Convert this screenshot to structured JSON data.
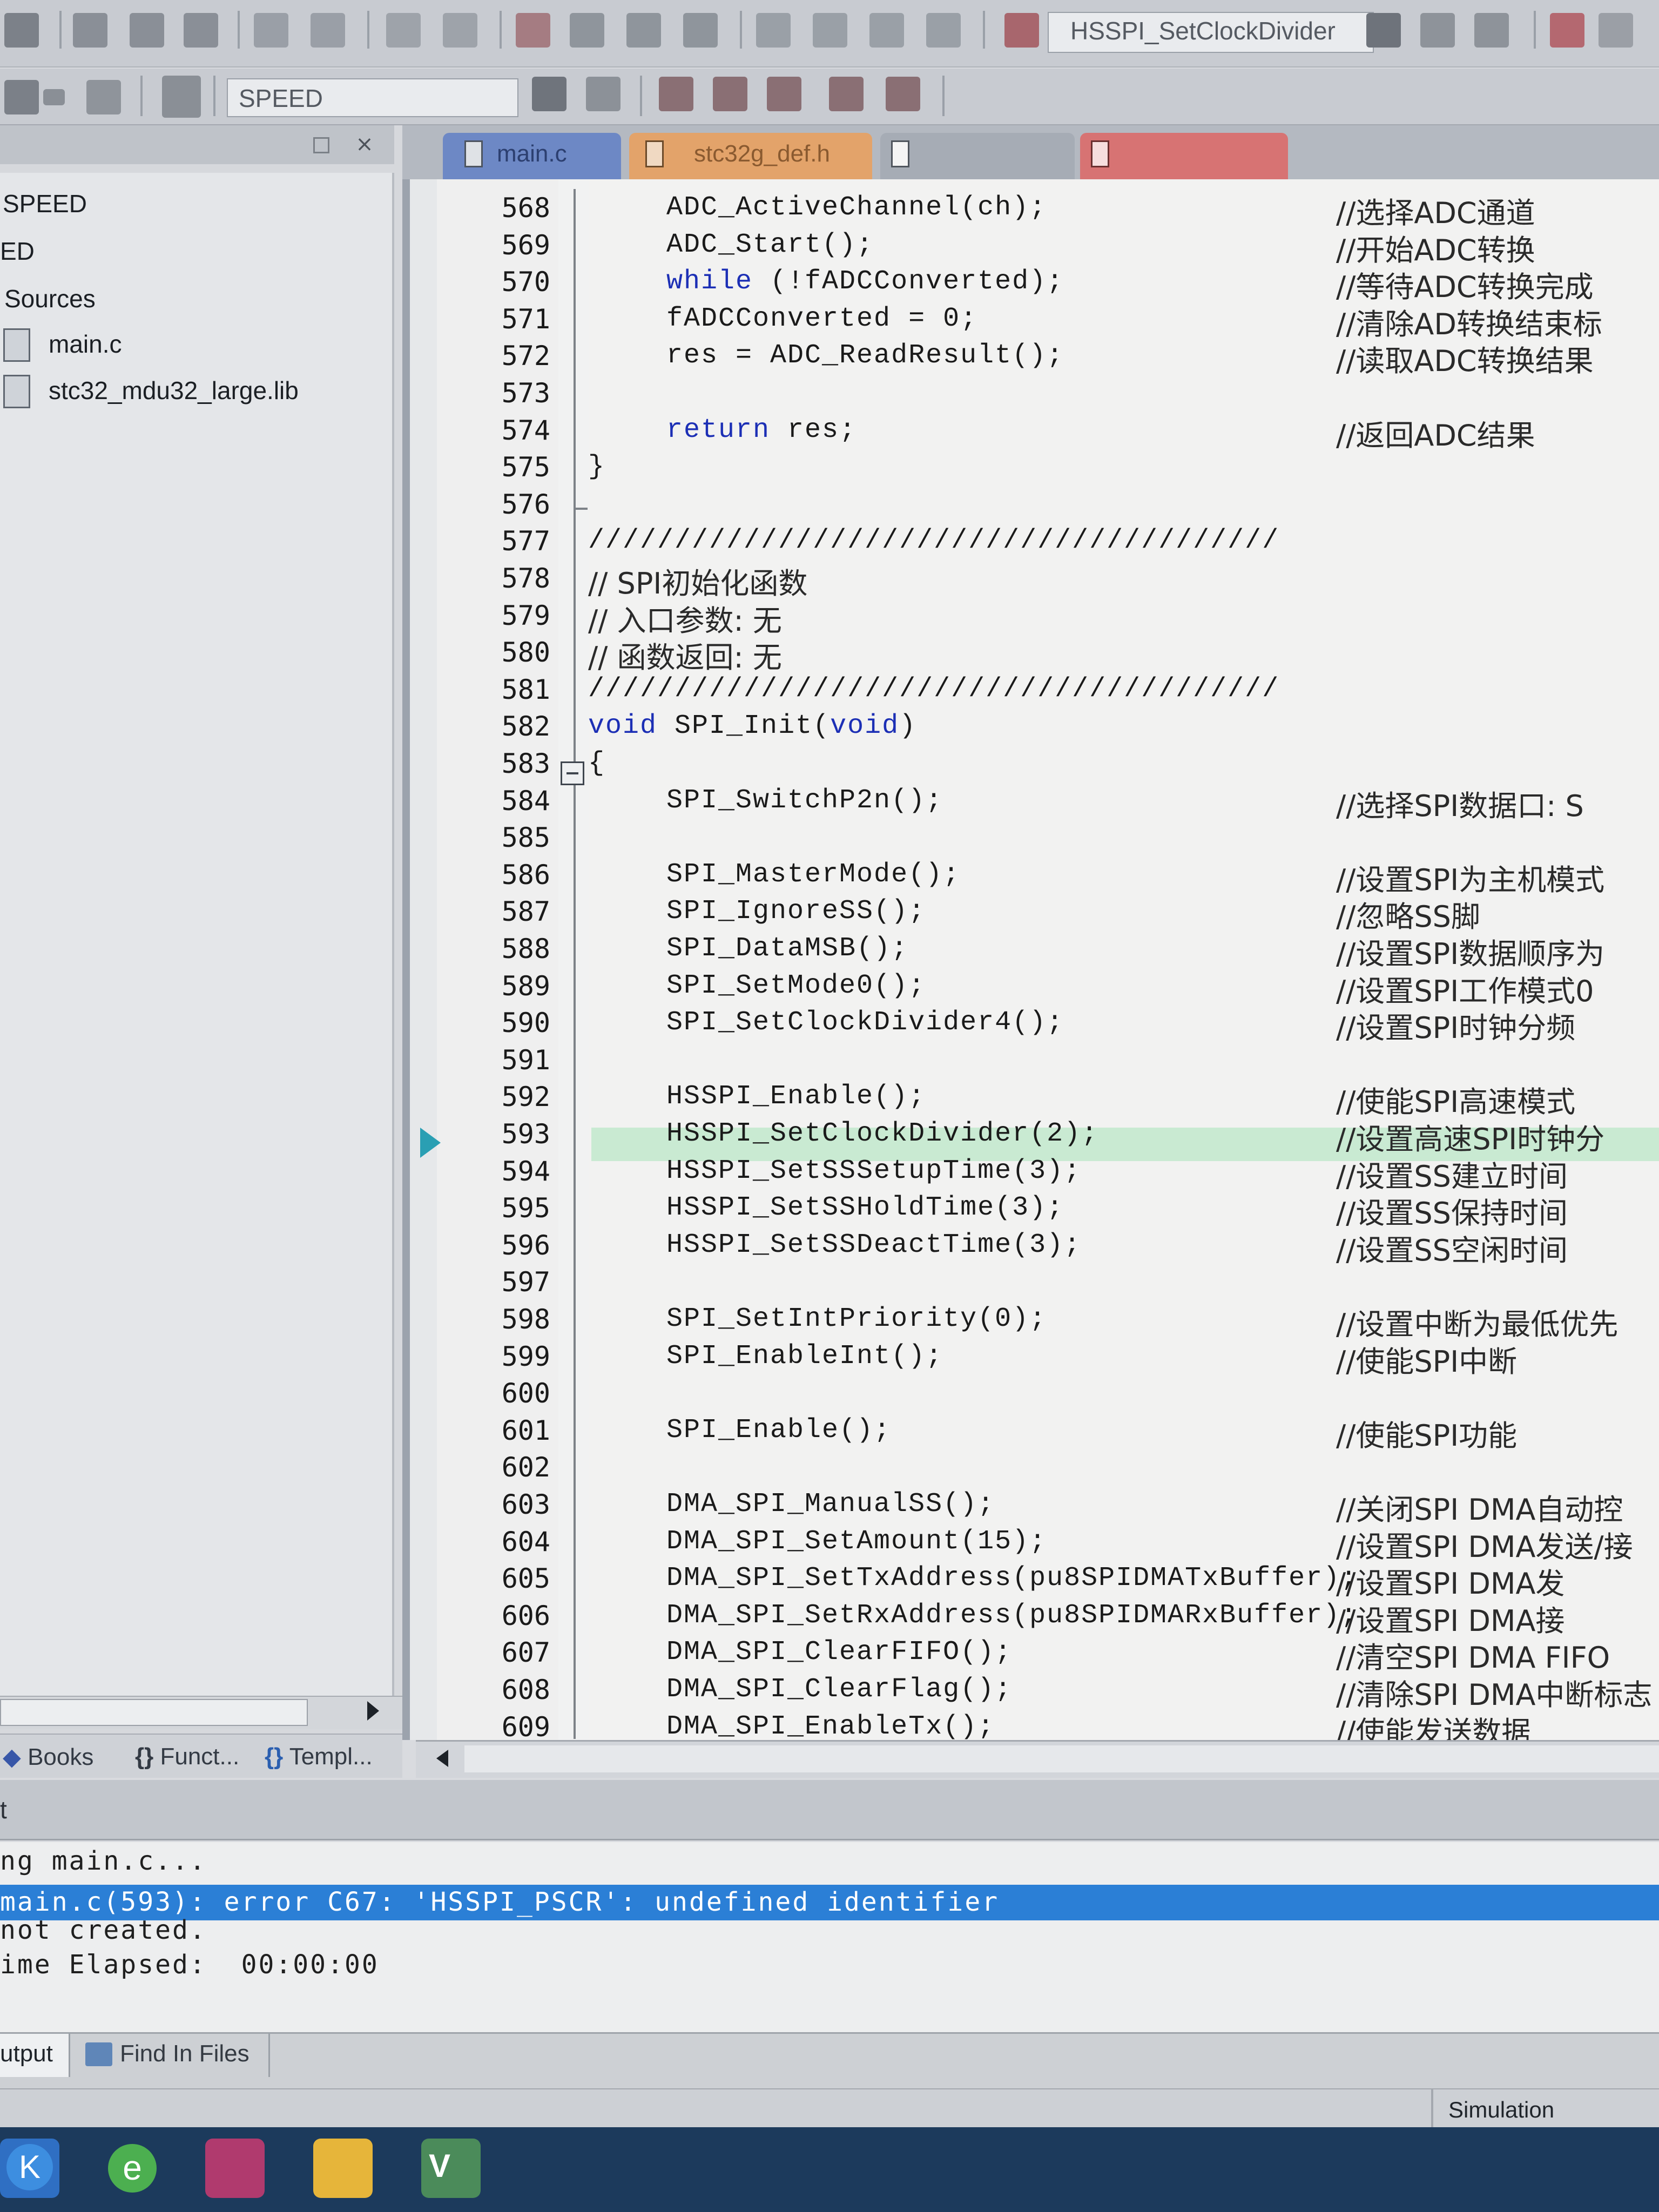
{
  "toolbar": {
    "function_combo": "HSSPI_SetClockDivider",
    "target_combo": "SPEED"
  },
  "project": {
    "items": [
      {
        "label": "SPEED"
      },
      {
        "label": "ED"
      },
      {
        "label": "Sources"
      },
      {
        "label": "main.c"
      },
      {
        "label": "stc32_mdu32_large.lib"
      }
    ],
    "tabs": [
      "Books",
      "Funct...",
      "Templ..."
    ]
  },
  "editor": {
    "tabs": [
      "main.c",
      "stc32g_def.h",
      "",
      ""
    ],
    "active_line": 593,
    "lines": [
      {
        "n": "568",
        "code": "ADC_ActiveChannel(ch);",
        "comment": "//选择ADC通道",
        "indent": 1
      },
      {
        "n": "569",
        "code": "ADC_Start();",
        "comment": "//开始ADC转换",
        "indent": 1
      },
      {
        "n": "570",
        "kw": "while",
        "code": " (!fADCConverted);",
        "comment": "//等待ADC转换完成",
        "indent": 1
      },
      {
        "n": "571",
        "code": "fADCConverted = 0;",
        "comment": "//清除AD转换结束标",
        "indent": 1
      },
      {
        "n": "572",
        "code": "res = ADC_ReadResult();",
        "comment": "//读取ADC转换结果",
        "indent": 1
      },
      {
        "n": "573",
        "code": "",
        "comment": "",
        "indent": 1
      },
      {
        "n": "574",
        "kw": "return",
        "code": " res;",
        "comment": "//返回ADC结果",
        "indent": 1
      },
      {
        "n": "575",
        "code": "}",
        "comment": "",
        "indent": 0
      },
      {
        "n": "576",
        "code": "",
        "comment": "",
        "indent": 0
      },
      {
        "n": "577",
        "code": "////////////////////////////////////////",
        "comment": "",
        "indent": 0
      },
      {
        "n": "578",
        "code": "",
        "comment": "// SPI初始化函数",
        "indent": 0,
        "comment_inline": true
      },
      {
        "n": "579",
        "code": "",
        "comment": "// 入口参数: 无",
        "indent": 0,
        "comment_inline": true
      },
      {
        "n": "580",
        "code": "",
        "comment": "// 函数返回: 无",
        "indent": 0,
        "comment_inline": true
      },
      {
        "n": "581",
        "code": "////////////////////////////////////////",
        "comment": "",
        "indent": 0
      },
      {
        "n": "582",
        "kw": "void",
        "code": " SPI_Init(",
        "kw2": "void",
        "code2": ")",
        "comment": "",
        "indent": 0
      },
      {
        "n": "583",
        "code": "{",
        "comment": "",
        "indent": 0
      },
      {
        "n": "584",
        "code": "SPI_SwitchP2n();",
        "comment": "//选择SPI数据口: S",
        "indent": 1
      },
      {
        "n": "585",
        "code": "",
        "comment": "",
        "indent": 1
      },
      {
        "n": "586",
        "code": "SPI_MasterMode();",
        "comment": "//设置SPI为主机模式",
        "indent": 1
      },
      {
        "n": "587",
        "code": "SPI_IgnoreSS();",
        "comment": "//忽略SS脚",
        "indent": 1
      },
      {
        "n": "588",
        "code": "SPI_DataMSB();",
        "comment": "//设置SPI数据顺序为",
        "indent": 1
      },
      {
        "n": "589",
        "code": "SPI_SetMode0();",
        "comment": "//设置SPI工作模式0",
        "indent": 1
      },
      {
        "n": "590",
        "code": "SPI_SetClockDivider4();",
        "comment": "//设置SPI时钟分频",
        "indent": 1
      },
      {
        "n": "591",
        "code": "",
        "comment": "",
        "indent": 1
      },
      {
        "n": "592",
        "code": "HSSPI_Enable();",
        "comment": "//使能SPI高速模式",
        "indent": 1
      },
      {
        "n": "593",
        "code": "HSSPI_SetClockDivider(2);",
        "comment": "//设置高速SPI时钟分",
        "indent": 1
      },
      {
        "n": "594",
        "code": "HSSPI_SetSSSetupTime(3);",
        "comment": "//设置SS建立时间",
        "indent": 1
      },
      {
        "n": "595",
        "code": "HSSPI_SetSSHoldTime(3);",
        "comment": "//设置SS保持时间",
        "indent": 1
      },
      {
        "n": "596",
        "code": "HSSPI_SetSSDeactTime(3);",
        "comment": "//设置SS空闲时间",
        "indent": 1
      },
      {
        "n": "597",
        "code": "",
        "comment": "",
        "indent": 1
      },
      {
        "n": "598",
        "code": "SPI_SetIntPriority(0);",
        "comment": "//设置中断为最低优先",
        "indent": 1
      },
      {
        "n": "599",
        "code": "SPI_EnableInt();",
        "comment": "//使能SPI中断",
        "indent": 1
      },
      {
        "n": "600",
        "code": "",
        "comment": "",
        "indent": 1
      },
      {
        "n": "601",
        "code": "SPI_Enable();",
        "comment": "//使能SPI功能",
        "indent": 1
      },
      {
        "n": "602",
        "code": "",
        "comment": "",
        "indent": 1
      },
      {
        "n": "603",
        "code": "DMA_SPI_ManualSS();",
        "comment": "//关闭SPI DMA自动控",
        "indent": 1
      },
      {
        "n": "604",
        "code": "DMA_SPI_SetAmount(15);",
        "comment": "//设置SPI DMA发送/接",
        "indent": 1
      },
      {
        "n": "605",
        "code": "DMA_SPI_SetTxAddress(pu8SPIDMATxBuffer);",
        "comment": "//设置SPI DMA发",
        "indent": 1
      },
      {
        "n": "606",
        "code": "DMA_SPI_SetRxAddress(pu8SPIDMARxBuffer);",
        "comment": "//设置SPI DMA接",
        "indent": 1
      },
      {
        "n": "607",
        "code": "DMA_SPI_ClearFIFO();",
        "comment": "//清空SPI DMA FIFO",
        "indent": 1
      },
      {
        "n": "608",
        "code": "DMA_SPI_ClearFlag();",
        "comment": "//清除SPI DMA中断标志",
        "indent": 1
      },
      {
        "n": "609",
        "code": "DMA_SPI_EnableTx();",
        "comment": "//使能发送数据",
        "indent": 1
      }
    ]
  },
  "output": {
    "title": "t",
    "lines": [
      "ng main.c...",
      "main.c(593): error C67: 'HSSPI_PSCR': undefined identifier",
      "not created.",
      "ime Elapsed:  00:00:00"
    ],
    "tabs": [
      "utput",
      "Find In Files"
    ]
  },
  "status": {
    "mode": "Simulation"
  },
  "colors": {
    "keyword": "#1c2fb5",
    "error_highlight": "#2b7fd6",
    "current_line": "#c9ead2",
    "execution_arrow": "#2a9fb3"
  },
  "taskbar": {
    "icons": [
      "keil-k-icon",
      "browser-e-icon",
      "app-icon",
      "folder-icon",
      "keil-uv-icon"
    ]
  }
}
